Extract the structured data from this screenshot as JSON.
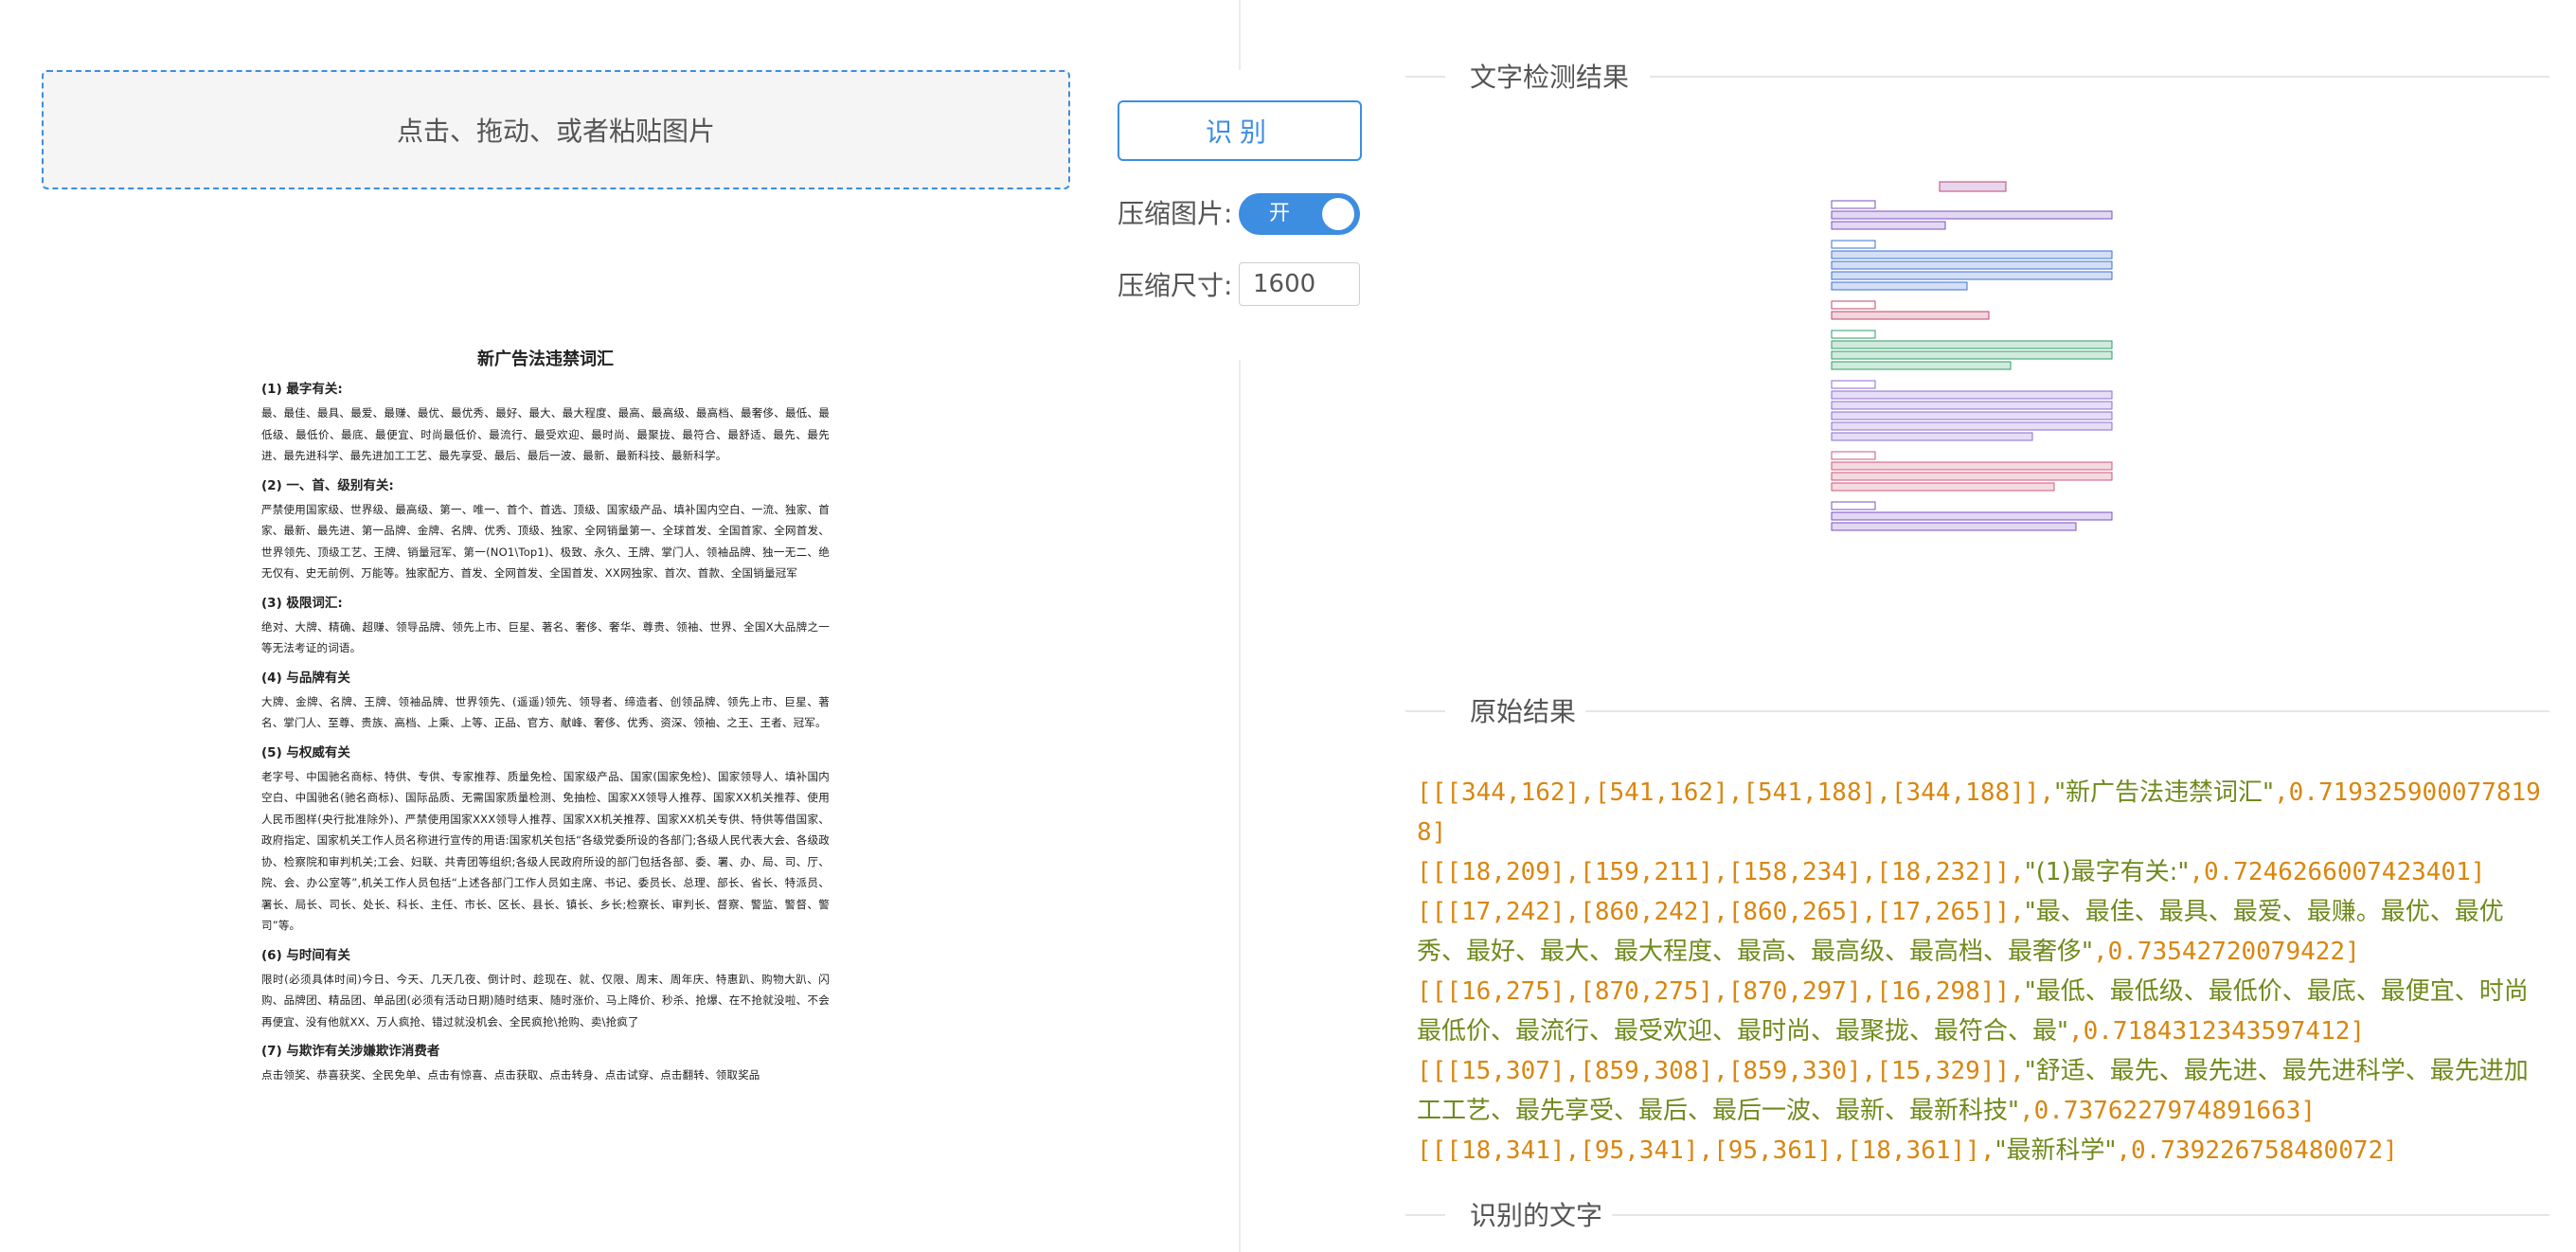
{
  "upload": {
    "hint": "点击、拖动、或者粘贴图片"
  },
  "controls": {
    "recognize_label": "识别",
    "compress_label": "压缩图片:",
    "toggle_text": "开",
    "toggle_on": true,
    "size_label": "压缩尺寸:",
    "size_value": "1600"
  },
  "sections": {
    "detection_title": "文字检测结果",
    "raw_title": "原始结果",
    "text_title": "识别的文字"
  },
  "colors": {
    "accent": "#3d8de0",
    "raw_string": "#6f8a1c",
    "raw_number": "#d9860f"
  },
  "document": {
    "title": "新广告法违禁词汇",
    "sections": [
      {
        "heading": "(1) 最字有关:",
        "body": "最、最佳、最具、最爱、最赚、最优、最优秀、最好、最大、最大程度、最高、最高级、最高档、最奢侈、最低、最低级、最低价、最底、最便宜、时尚最低价、最流行、最受欢迎、最时尚、最聚拢、最符合、最舒适、最先、最先进、最先进科学、最先进加工工艺、最先享受、最后、最后一波、最新、最新科技、最新科学。"
      },
      {
        "heading": "(2) 一、首、级别有关:",
        "body": "严禁使用国家级、世界级、最高级、第一、唯一、首个、首选、顶级、国家级产品、填补国内空白、一流、独家、首家、最新、最先进、第一品牌、金牌、名牌、优秀、顶级、独家、全网销量第一、全球首发、全国首家、全网首发、世界领先、顶级工艺、王牌、销量冠军、第一(NO1\\Top1)、极致、永久、王牌、掌门人、领袖品牌、独一无二、绝无仅有、史无前例、万能等。独家配方、首发、全网首发、全国首发、XX网独家、首次、首款、全国销量冠军"
      },
      {
        "heading": "(3) 极限词汇:",
        "body": "绝对、大牌、精确、超赚、领导品牌、领先上市、巨星、著名、奢侈、奢华、尊贵、领袖、世界、全国X大品牌之一等无法考证的词语。"
      },
      {
        "heading": "(4) 与品牌有关",
        "body": "大牌、金牌、名牌、王牌、领袖品牌、世界领先、(遥遥)领先、领导者、缔造者、创领品牌、领先上市、巨星、著名、掌门人、至尊、贵族、高档、上乘、上等、正品、官方、献峰、奢侈、优秀、资深、领袖、之王、王者、冠军。"
      },
      {
        "heading": "(5) 与权威有关",
        "body": "老字号、中国驰名商标、特供、专供、专家推荐、质量免检、国家级产品、国家(国家免检)、国家领导人、填补国内空白、中国驰名(驰名商标)、国际品质、无需国家质量检测、免抽检、国家XX领导人推荐、国家XX机关推荐、使用人民币图样(央行批准除外)、严禁使用国家XXX领导人推荐、国家XX机关推荐、国家XX机关专供、特供等借国家、政府指定、国家机关工作人员名称进行宣传的用语:国家机关包括“各级党委所设的各部门;各级人民代表大会、各级政协、检察院和审判机关;工会、妇联、共青团等组织;各级人民政府所设的部门包括各部、委、署、办、局、司、厅、院、会、办公室等”,机关工作人员包括“上述各部门工作人员如主席、书记、委员长、总理、部长、省长、特派员、署长、局长、司长、处长、科长、主任、市长、区长、县长、镇长、乡长;检察长、审判长、督察、警监、警督、警司”等。"
      },
      {
        "heading": "(6) 与时间有关",
        "body": "限时(必须具体时间)今日、今天、几天几夜、倒计时、趁现在、就、仅限、周末、周年庆、特惠趴、购物大趴、闪购、品牌团、精品团、单品团(必须有活动日期)随时结束、随时涨价、马上降价、秒杀、抢爆、在不抢就没啦、不会再便宜、没有他就XX、万人疯抢、错过就没机会、全民疯抢\\抢购、卖\\抢疯了"
      },
      {
        "heading": "(7) 与欺诈有关涉嫌欺诈消费者",
        "body": "点击领奖、恭喜获奖、全民免单、点击有惊喜、点击获取、点击转身、点击试穿、点击翻转、领取奖品"
      }
    ]
  },
  "raw_results": [
    {
      "box": "[[[344,162],[541,162],[541,188],[344,188]],",
      "text": "\"新广告法违禁词汇\"",
      "score": ",0.7193259000778198]"
    },
    {
      "box": "[[[18,209],[159,211],[158,234],[18,232]],",
      "text": "\"(1)最字有关:\"",
      "score": ",0.7246266007423401]"
    },
    {
      "box": "[[[17,242],[860,242],[860,265],[17,265]],",
      "text": "\"最、最佳、最具、最爱、最赚。最优、最优秀、最好、最大、最大程度、最高、最高级、最高档、最奢侈\"",
      "score": ",0.73542720079422]"
    },
    {
      "box": "[[[16,275],[870,275],[870,297],[16,298]],",
      "text": "\"最低、最低级、最低价、最底、最便宜、时尚最低价、最流行、最受欢迎、最时尚、最聚拢、最符合、最\"",
      "score": ",0.7184312343597412]"
    },
    {
      "box": "[[[15,307],[859,308],[859,330],[15,329]],",
      "text": "\"舒适、最先、最先进、最先进科学、最先进加工工艺、最先享受、最后、最后一波、最新、最新科技\"",
      "score": ",0.7376227974891663]"
    },
    {
      "box": "[[[18,341],[95,341],[95,361],[18,361]],",
      "text": "\"最新科学\"",
      "score": ",0.739226758480072]"
    }
  ]
}
